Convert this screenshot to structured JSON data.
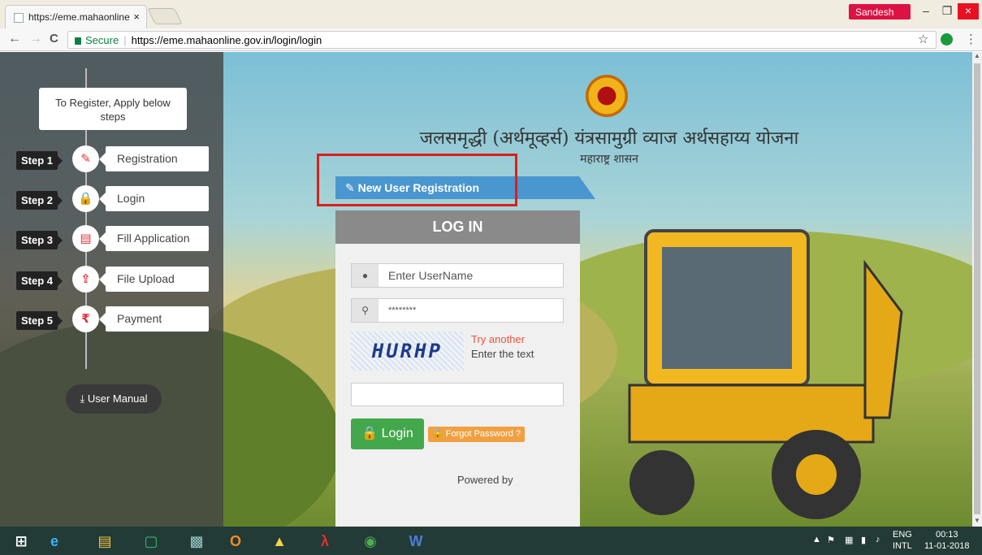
{
  "browser": {
    "tab_title": "https://eme.mahaonline",
    "tab_close": "×",
    "profile_name": "Sandesh",
    "window_min": "–",
    "window_max": "❐",
    "window_close": "×",
    "back": "←",
    "forward": "→",
    "reload": "C",
    "secure_label": "Secure",
    "url": "https://eme.mahaonline.gov.in/login/login",
    "bookmark_star": "☆",
    "menu": "⋮"
  },
  "sidebar": {
    "info_text": "To Register, Apply below steps",
    "steps": [
      {
        "step": "Step 1",
        "name": "Registration",
        "icon": "✎"
      },
      {
        "step": "Step 2",
        "name": "Login",
        "icon": "🔒"
      },
      {
        "step": "Step 3",
        "name": "Fill Application",
        "icon": "▤"
      },
      {
        "step": "Step 4",
        "name": "File Upload",
        "icon": "⇪"
      },
      {
        "step": "Step 5",
        "name": "Payment",
        "icon": "₹"
      }
    ],
    "user_manual": "⤓ User Manual"
  },
  "header": {
    "scheme_title": "जलसमृद्धी (अर्थमूव्हर्स) यंत्रसामुग्री व्याज अर्थसहाय्य योजना",
    "govt_name": "महाराष्ट्र शासन"
  },
  "new_registration": "✎ New User Registration",
  "login": {
    "title": "LOG IN",
    "username_placeholder": "Enter UserName",
    "password_value": "********",
    "captcha_text": "HURHP",
    "try_another": "Try another",
    "enter_text": "Enter the text",
    "login_button": "Login",
    "forgot_password": "Forgot Password ?",
    "powered_by": "Powered by"
  },
  "taskbar": {
    "lang_top": "ENG",
    "lang_bottom": "INTL",
    "time": "00:13",
    "date": "11-01-2018"
  },
  "colors": {
    "accent_blue": "#4a96cf",
    "login_green": "#43a84b",
    "forgot_orange": "#f0a040",
    "highlight_red": "#d9201b"
  }
}
